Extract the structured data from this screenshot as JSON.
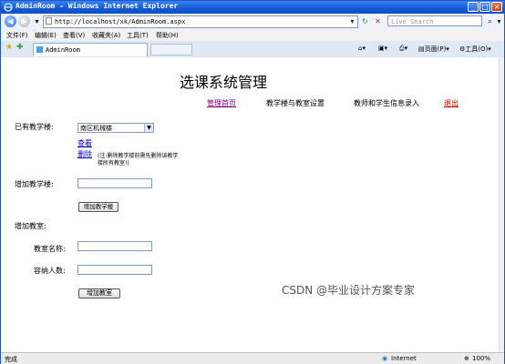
{
  "window": {
    "title": "AdminRoom - Windows Internet Explorer",
    "minimize": "_",
    "maximize": "□",
    "close": "×"
  },
  "addressbar": {
    "url": "http://localhost/xk/AdminRoom.aspx",
    "search_placeholder": "Live Search"
  },
  "menu": [
    "文件(F)",
    "编辑(E)",
    "查看(V)",
    "收藏夹(A)",
    "工具(T)",
    "帮助(H)"
  ],
  "tabbar": {
    "tab_title": "AdminRoom",
    "page_label": "页面(P)",
    "tools_label": "工具(O)"
  },
  "page": {
    "title": "选课系统管理",
    "nav": [
      "管理首页",
      "教学楼与教室设置",
      "教师和学生信息录入",
      "退出"
    ],
    "nav_colors": {
      "home": "#800080",
      "logout": "#cc0000"
    },
    "existing_building_label": "已有教学楼:",
    "building_selected": "南区机械楼",
    "view_link": "查看",
    "delete_link": "删除",
    "delete_note": "(注:删除教学楼前需先删除该教学楼所有教室!)",
    "add_building_label": "增加教学楼:",
    "add_building_value": "",
    "add_building_button": "增加教学楼",
    "add_room_label": "增加教室:",
    "room_name_label": "教室名称:",
    "room_name_value": "",
    "capacity_label": "容纳人数:",
    "capacity_value": "",
    "add_room_button": "增加教室"
  },
  "watermark": "CSDN @毕业设计方案专家",
  "statusbar": {
    "status": "完成",
    "zone": "Internet",
    "zoom": "100%"
  }
}
